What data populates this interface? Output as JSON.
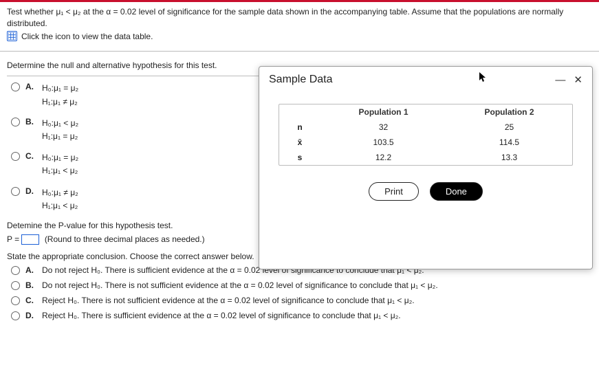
{
  "intro": {
    "line1": "Test whether μ₁ < μ₂ at the α = 0.02 level of significance for the sample data shown in the accompanying table. Assume that the populations are normally distributed.",
    "line2": "Click the icon to view the data table."
  },
  "q1": {
    "prompt": "Determine the null and alternative hypothesis for this test.",
    "options": {
      "A": {
        "label": "A.",
        "l1": "H₀:μ₁ = μ₂",
        "l2": "H₁:μ₁ ≠ μ₂"
      },
      "B": {
        "label": "B.",
        "l1": "H₀:μ₁ < μ₂",
        "l2": "H₁:μ₁ = μ₂"
      },
      "C": {
        "label": "C.",
        "l1": "H₀:μ₁ = μ₂",
        "l2": "H₁:μ₁ < μ₂"
      },
      "D": {
        "label": "D.",
        "l1": "H₀:μ₁ ≠ μ₂",
        "l2": "H₁:μ₁ < μ₂"
      }
    }
  },
  "pvalue": {
    "prompt": "Detemine the P-value for this hypothesis test.",
    "expr_prefix": "P = ",
    "note": "(Round to three decimal places as needed.)"
  },
  "conclusion": {
    "prompt": "State the appropriate conclusion. Choose the correct answer below.",
    "options": {
      "A": {
        "label": "A.",
        "text": "Do not reject H₀. There is sufficient evidence at the α = 0.02 level of significance to conclude that μ₁ < μ₂."
      },
      "B": {
        "label": "B.",
        "text": "Do not reject H₀. There is not sufficient evidence at the α = 0.02 level of significance to conclude that μ₁ < μ₂."
      },
      "C": {
        "label": "C.",
        "text": "Reject H₀. There is not sufficient evidence at the α = 0.02 level of significance to conclude that μ₁ < μ₂."
      },
      "D": {
        "label": "D.",
        "text": "Reject H₀. There is sufficient evidence at the α = 0.02 level of significance to conclude that μ₁ < μ₂."
      }
    }
  },
  "modal": {
    "title": "Sample Data",
    "minimize": "—",
    "close": "✕",
    "headers": {
      "blank": "",
      "pop1": "Population 1",
      "pop2": "Population 2"
    },
    "rows": {
      "n": {
        "label": "n",
        "p1": "32",
        "p2": "25"
      },
      "x": {
        "label": "x̄",
        "p1": "103.5",
        "p2": "114.5"
      },
      "s": {
        "label": "s",
        "p1": "12.2",
        "p2": "13.3"
      }
    },
    "buttons": {
      "print": "Print",
      "done": "Done"
    }
  },
  "chart_data": {
    "type": "table",
    "title": "Sample Data",
    "columns": [
      "",
      "Population 1",
      "Population 2"
    ],
    "rows": [
      [
        "n",
        32,
        25
      ],
      [
        "x̄",
        103.5,
        114.5
      ],
      [
        "s",
        12.2,
        13.3
      ]
    ]
  }
}
